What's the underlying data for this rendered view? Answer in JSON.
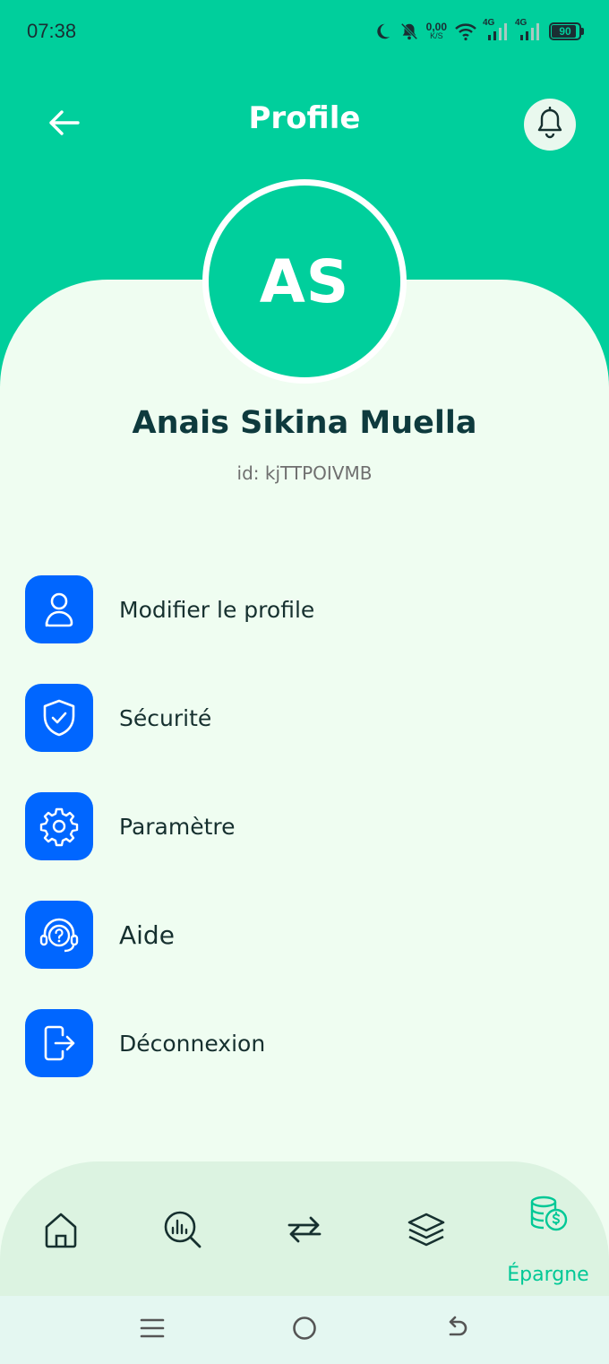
{
  "status_bar": {
    "time": "07:38",
    "net_speed_value": "0,00",
    "net_speed_unit": "K/S",
    "sim1_label": "4G",
    "sim2_label": "4G",
    "battery_level": "90",
    "icons": [
      "moon-icon",
      "bell-muted-icon",
      "wifi-icon",
      "signal-icon",
      "signal-icon",
      "battery-icon"
    ]
  },
  "header": {
    "title": "Profile",
    "back_icon": "arrow-left-icon",
    "notification_icon": "bell-icon"
  },
  "profile": {
    "initials": "AS",
    "name": "Anais Sikina Muella",
    "id_text": "id: kjTTPOIVMB"
  },
  "menu": {
    "items": [
      {
        "label": "Modifier le profile",
        "icon": "user-icon"
      },
      {
        "label": "Sécurité",
        "icon": "shield-check-icon"
      },
      {
        "label": "Paramètre",
        "icon": "gear-icon"
      },
      {
        "label": "Aide",
        "icon": "support-icon"
      },
      {
        "label": "Déconnexion",
        "icon": "logout-icon"
      }
    ]
  },
  "bottom_nav": {
    "items": [
      {
        "icon": "home-icon"
      },
      {
        "icon": "analytics-search-icon"
      },
      {
        "icon": "transfer-icon"
      },
      {
        "icon": "layers-icon"
      },
      {
        "icon": "savings-icon",
        "label": "Épargne",
        "active": true
      }
    ]
  },
  "system_nav": {
    "icons": [
      "menu-icon",
      "home-circle-icon",
      "back-icon"
    ]
  },
  "colors": {
    "primary_green": "#00CF9C",
    "sheet_bg": "#EFFDF1",
    "menu_icon_bg": "#0066FF",
    "name_text": "#0e3a3d",
    "nav_bg": "#DCF3E1",
    "nav_active": "#00C896"
  }
}
